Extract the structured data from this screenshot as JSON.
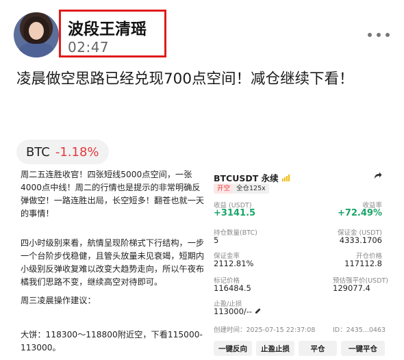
{
  "author": {
    "name": "波段王清瑶",
    "time": "02:47"
  },
  "post": {
    "text": "凌晨做空思路已经兑现700点空间！减仓继续下看！"
  },
  "ticker": {
    "symbol": "BTC",
    "change": "-1.18%",
    "change_color": "#e5383b"
  },
  "article": {
    "paragraphs": [
      "周二五连胜收官！四张短线5000点空间，一张4000点中线！周二的行情也是提示的非常明确反弹做空！一路连胜出局，长空短多！翻苍也就一天的事情！",
      "四小时级别来看，航情呈现阶梯式下行结构，一步一个台阶步伐稳健，且管头放量未见衰竭，短期内小级别反弹收复难以改变大趋势走向，所以午夜布橘我们思路不变，继续高空对待即可。",
      "周三凌晨操作建议：",
      "大饼：118300～118800附近空，下看115000-113000。"
    ]
  },
  "position_card": {
    "pair": "BTCUSDT 永续",
    "tag_side": "开空",
    "tag_margin": "全仓125x",
    "pnl_label": "收益 (USDT)",
    "pnl_value": "+3141.5",
    "roi_label": "收益率",
    "roi_value": "+72.49%",
    "size_label": "持仓数量(BTC)",
    "size_value": "5",
    "margin_label": "保证金 (USDT)",
    "margin_value": "4333.1706",
    "margin_ratio_label": "保证金率",
    "margin_ratio_value": "2112.81%",
    "entry_label": "开仓价格",
    "entry_value": "117112.8",
    "mark_label": "标记价格",
    "mark_value": "116484.5",
    "liq_label": "预估强平价(USDT)",
    "liq_value": "129077.4",
    "tpsl_label": "止盈/止损",
    "tpsl_value": "113000/--",
    "created_label": "创建时间：2025-07-15 22:37:08",
    "id_label": "ID：2435...0463",
    "buttons": [
      "一键反向",
      "止盈止损",
      "平仓",
      "一键平仓"
    ],
    "profit_color": "#1aa56a"
  }
}
